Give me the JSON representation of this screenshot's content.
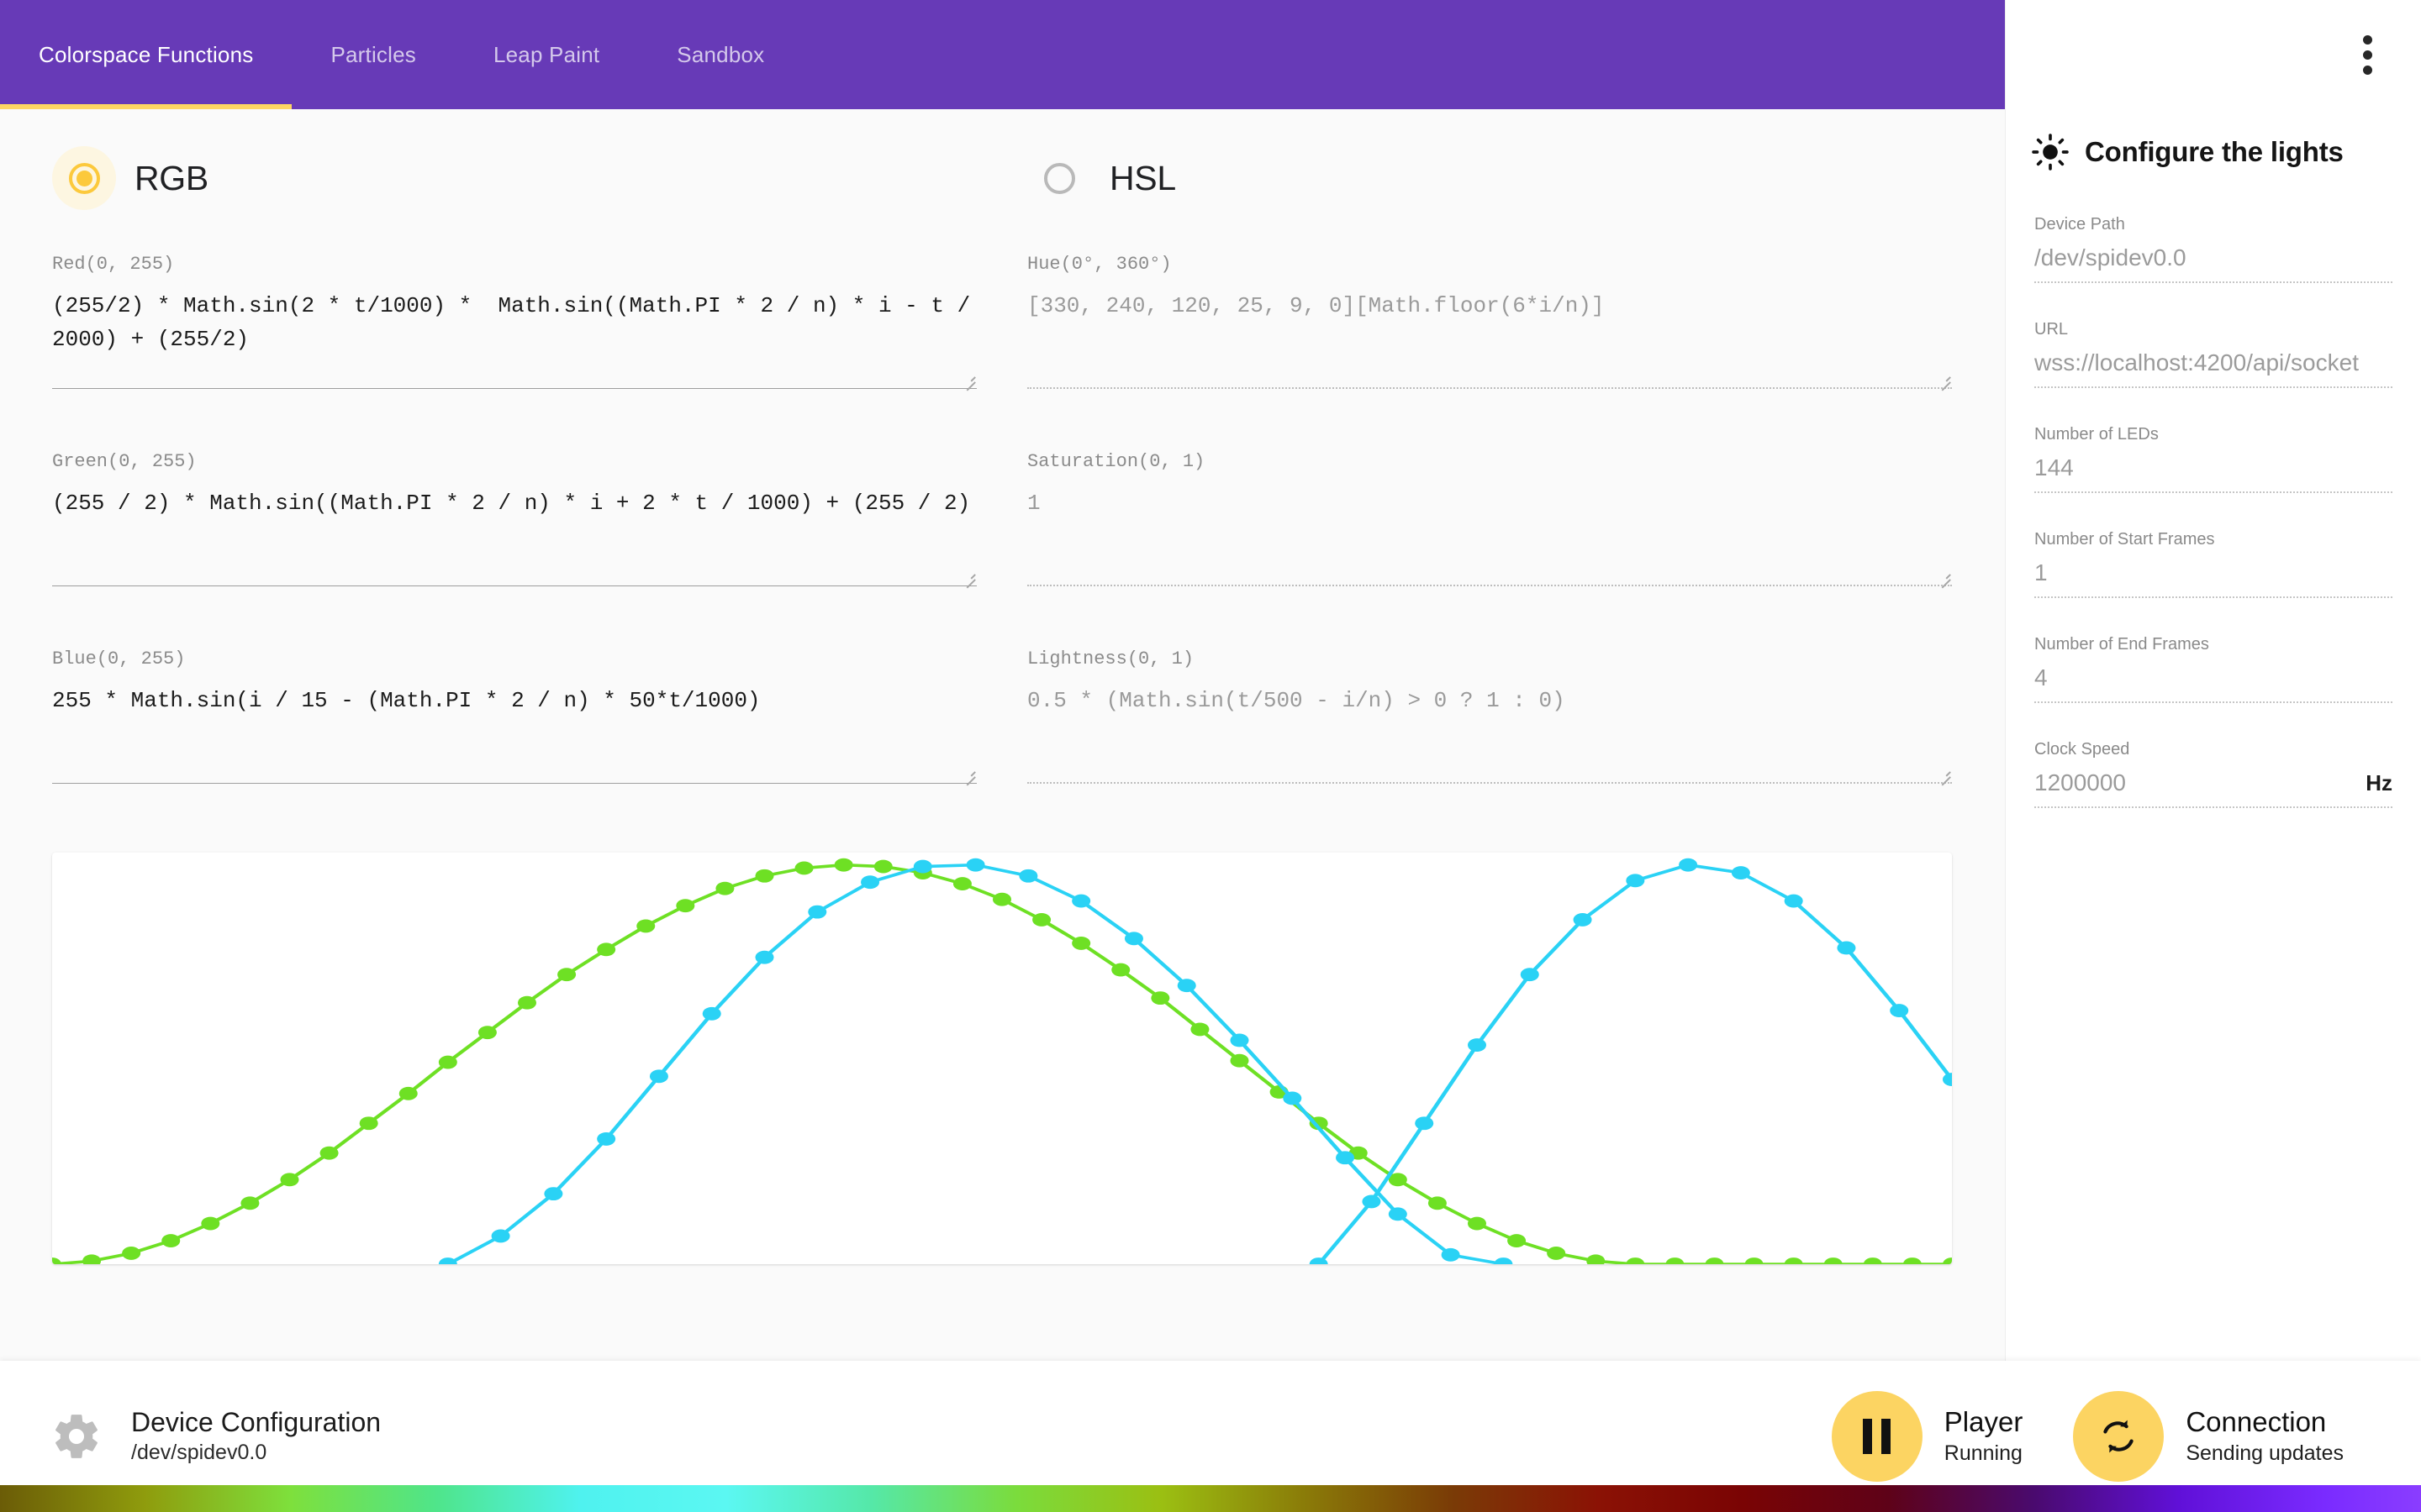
{
  "app": {
    "accent_purple": "#673ab7",
    "accent_yellow": "#fdd663",
    "fab_yellow": "#fcd462"
  },
  "tabs": [
    {
      "label": "Colorspace Functions",
      "active": true
    },
    {
      "label": "Particles",
      "active": false
    },
    {
      "label": "Leap Paint",
      "active": false
    },
    {
      "label": "Sandbox",
      "active": false
    }
  ],
  "modes": {
    "rgb": {
      "label": "RGB",
      "selected": true
    },
    "hsl": {
      "label": "HSL",
      "selected": false
    }
  },
  "rgb_fields": [
    {
      "label": "Red(0, 255)",
      "value": "(255/2) * Math.sin(2 * t/1000) *  Math.sin((Math.PI * 2 / n) * i - t / 2000) + (255/2)"
    },
    {
      "label": "Green(0, 255)",
      "value": "(255 / 2) * Math.sin((Math.PI * 2 / n) * i + 2 * t / 1000) + (255 / 2)"
    },
    {
      "label": "Blue(0, 255)",
      "value": "255 * Math.sin(i / 15 - (Math.PI * 2 / n) * 50*t/1000)"
    }
  ],
  "hsl_fields": [
    {
      "label": "Hue(0°, 360°)",
      "value": "[330, 240, 120, 25, 9, 0][Math.floor(6*i/n)]"
    },
    {
      "label": "Saturation(0, 1)",
      "value": "1"
    },
    {
      "label": "Lightness(0, 1)",
      "value": "0.5 * (Math.sin(t/500 - i/n) > 0 ? 1 : 0)"
    }
  ],
  "sidebar": {
    "title": "Configure the lights",
    "icon": "brightness-sun-icon",
    "menu_icon": "more-vert-icon",
    "fields": [
      {
        "label": "Device Path",
        "value": "/dev/spidev0.0",
        "suffix": ""
      },
      {
        "label": "URL",
        "value": "wss://localhost:4200/api/socket",
        "suffix": ""
      },
      {
        "label": "Number of LEDs",
        "value": "144",
        "suffix": ""
      },
      {
        "label": "Number of Start Frames",
        "value": "1",
        "suffix": ""
      },
      {
        "label": "Number of End Frames",
        "value": "4",
        "suffix": ""
      },
      {
        "label": "Clock Speed",
        "value": "1200000",
        "suffix": "Hz"
      }
    ]
  },
  "bottom_bar": {
    "device": {
      "icon": "gear-icon",
      "title": "Device Configuration",
      "subtitle": "/dev/spidev0.0"
    },
    "player": {
      "icon": "pause-icon",
      "title": "Player",
      "status": "Running"
    },
    "connection": {
      "icon": "sync-icon",
      "title": "Connection",
      "status": "Sending updates"
    }
  },
  "chart_data": {
    "type": "line",
    "title": "",
    "xlabel": "",
    "ylabel": "",
    "grid": false,
    "legend": "none",
    "xlim": [
      0,
      144
    ],
    "ylim": [
      0,
      255
    ],
    "series": [
      {
        "name": "green-channel",
        "color": "#6ee024",
        "marker": "circle",
        "x": [
          0,
          3,
          6,
          9,
          12,
          15,
          18,
          21,
          24,
          27,
          30,
          33,
          36,
          39,
          42,
          45,
          48,
          51,
          54,
          57,
          60,
          63,
          66,
          69,
          72,
          75,
          78,
          81,
          84,
          87,
          90,
          93,
          96,
          99,
          102,
          105,
          108,
          111,
          114,
          117,
          120,
          123,
          126,
          129,
          132,
          135,
          138,
          141,
          144
        ],
        "y": [
          0,
          2,
          7,
          15,
          26,
          39,
          54,
          71,
          90,
          109,
          129,
          148,
          167,
          185,
          201,
          216,
          229,
          240,
          248,
          253,
          255,
          254,
          250,
          243,
          233,
          220,
          205,
          188,
          170,
          150,
          130,
          110,
          90,
          71,
          54,
          39,
          26,
          15,
          7,
          2,
          0,
          0,
          0,
          0,
          0,
          0,
          0,
          0,
          0
        ]
      },
      {
        "name": "cyan-channel-left",
        "color": "#2ad2f5",
        "marker": "circle",
        "x": [
          30,
          34,
          38,
          42,
          46,
          50,
          54,
          58,
          62,
          66,
          70,
          74,
          78,
          82,
          86,
          90,
          94,
          98,
          102,
          106,
          110
        ],
        "y": [
          0,
          18,
          45,
          80,
          120,
          160,
          196,
          225,
          244,
          254,
          255,
          248,
          232,
          208,
          178,
          143,
          106,
          68,
          32,
          6,
          0
        ]
      },
      {
        "name": "cyan-channel-right",
        "color": "#2ad2f5",
        "marker": "circle",
        "x": [
          96,
          100,
          104,
          108,
          112,
          116,
          120,
          124,
          128,
          132,
          136,
          140,
          144
        ],
        "y": [
          0,
          40,
          90,
          140,
          185,
          220,
          245,
          255,
          250,
          232,
          202,
          162,
          118
        ]
      }
    ]
  },
  "gradient_strip": {
    "name": "led-strip-preview",
    "stops": [
      {
        "pos": 0,
        "color": "#6b5c07"
      },
      {
        "pos": 6,
        "color": "#8f9c0d"
      },
      {
        "pos": 12,
        "color": "#7ee03c"
      },
      {
        "pos": 18,
        "color": "#4fe58a"
      },
      {
        "pos": 24,
        "color": "#4ff2ef"
      },
      {
        "pos": 30,
        "color": "#5bf7f2"
      },
      {
        "pos": 36,
        "color": "#55e8a8"
      },
      {
        "pos": 42,
        "color": "#7bdc3c"
      },
      {
        "pos": 48,
        "color": "#9bbf12"
      },
      {
        "pos": 54,
        "color": "#8a7a08"
      },
      {
        "pos": 60,
        "color": "#7a3b06"
      },
      {
        "pos": 66,
        "color": "#8b1205"
      },
      {
        "pos": 72,
        "color": "#7a0404"
      },
      {
        "pos": 78,
        "color": "#5e0218"
      },
      {
        "pos": 84,
        "color": "#4a0a6e"
      },
      {
        "pos": 90,
        "color": "#6010d8"
      },
      {
        "pos": 96,
        "color": "#7a2bff"
      },
      {
        "pos": 100,
        "color": "#8a3dff"
      }
    ]
  }
}
